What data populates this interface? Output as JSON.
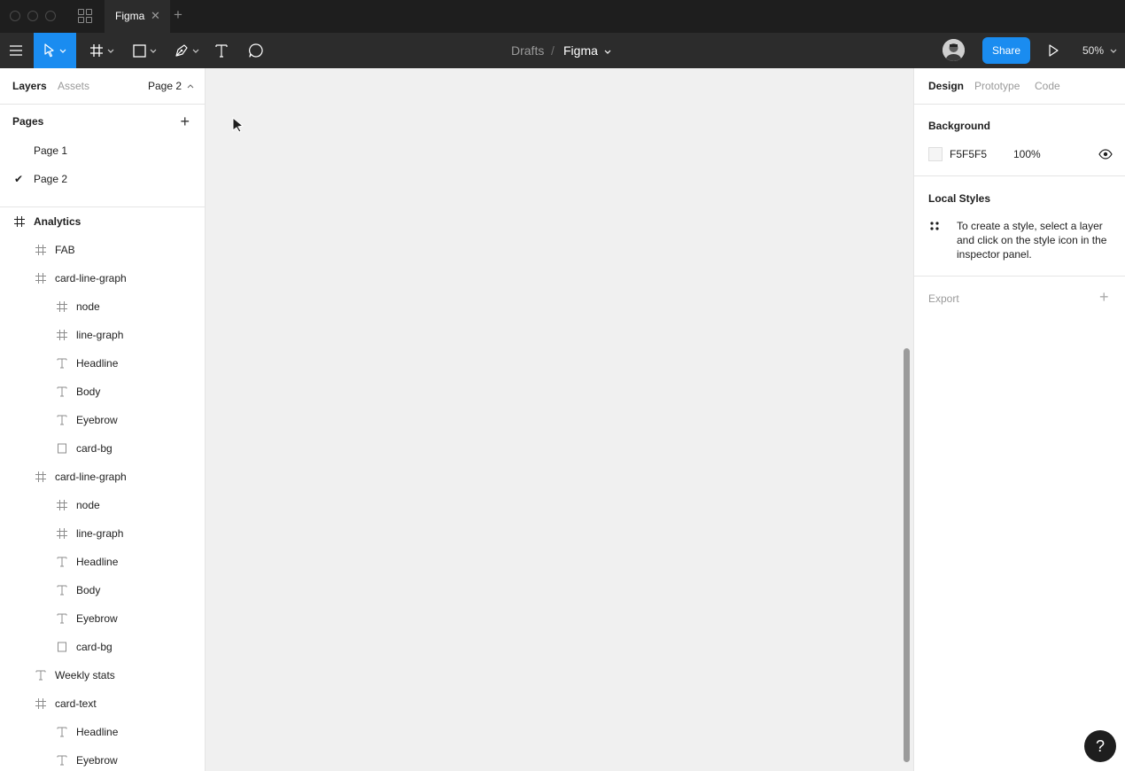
{
  "titlebar": {
    "tab_title": "Figma",
    "tab_close": "✕",
    "new_tab": "+"
  },
  "toolbar": {
    "breadcrumb_parent": "Drafts",
    "breadcrumb_sep": "/",
    "file_name": "Figma",
    "share_label": "Share",
    "zoom_label": "50%",
    "accent_color": "#1a8cf0"
  },
  "left_panel": {
    "tab_layers": "Layers",
    "tab_assets": "Assets",
    "current_page": "Page 2",
    "pages_title": "Pages",
    "pages": [
      "Page 1",
      "Page 2"
    ],
    "selected_page": "Page 2",
    "layers": [
      {
        "name": "Analytics",
        "type": "frame",
        "depth": 0
      },
      {
        "name": "FAB",
        "type": "frame",
        "depth": 1
      },
      {
        "name": "card-line-graph",
        "type": "frame",
        "depth": 1
      },
      {
        "name": "node",
        "type": "frame",
        "depth": 2
      },
      {
        "name": "line-graph",
        "type": "frame",
        "depth": 2
      },
      {
        "name": "Headline",
        "type": "text",
        "depth": 2
      },
      {
        "name": "Body",
        "type": "text",
        "depth": 2
      },
      {
        "name": "Eyebrow",
        "type": "text",
        "depth": 2
      },
      {
        "name": "card-bg",
        "type": "rect",
        "depth": 2
      },
      {
        "name": "card-line-graph",
        "type": "frame",
        "depth": 1
      },
      {
        "name": "node",
        "type": "frame",
        "depth": 2
      },
      {
        "name": "line-graph",
        "type": "frame",
        "depth": 2
      },
      {
        "name": "Headline",
        "type": "text",
        "depth": 2
      },
      {
        "name": "Body",
        "type": "text",
        "depth": 2
      },
      {
        "name": "Eyebrow",
        "type": "text",
        "depth": 2
      },
      {
        "name": "card-bg",
        "type": "rect",
        "depth": 2
      },
      {
        "name": "Weekly stats",
        "type": "text",
        "depth": 1
      },
      {
        "name": "card-text",
        "type": "frame",
        "depth": 1
      },
      {
        "name": "Headline",
        "type": "text",
        "depth": 2
      },
      {
        "name": "Eyebrow",
        "type": "text",
        "depth": 2
      }
    ]
  },
  "right_panel": {
    "tab_design": "Design",
    "tab_prototype": "Prototype",
    "tab_code": "Code",
    "background_title": "Background",
    "bg_hex": "F5F5F5",
    "bg_opacity": "100%",
    "bg_color": "#f5f5f5",
    "local_styles_title": "Local Styles",
    "local_styles_hint": "To create a style, select a layer and click on the style icon in the inspector panel.",
    "export_title": "Export",
    "export_add": "+"
  },
  "help_label": "?"
}
